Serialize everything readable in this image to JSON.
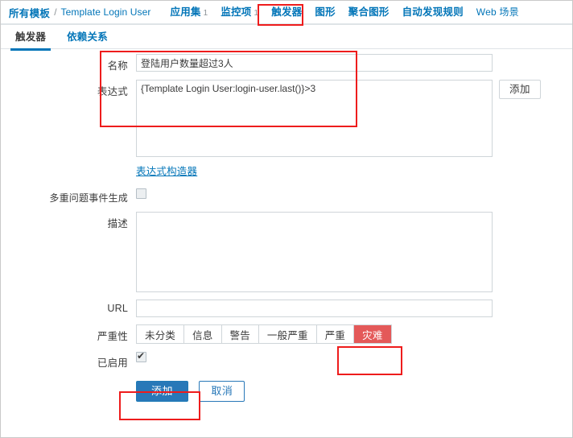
{
  "breadcrumb": {
    "root_label": "所有模板",
    "separator": "/",
    "template_name": "Template Login User"
  },
  "nav_tabs": [
    {
      "label": "应用集",
      "count": "1",
      "active": false,
      "latin": false
    },
    {
      "label": "监控项",
      "count": "1",
      "active": false,
      "latin": false
    },
    {
      "label": "触发器",
      "count": "",
      "active": true,
      "latin": false
    },
    {
      "label": "图形",
      "count": "",
      "active": false,
      "latin": false
    },
    {
      "label": "聚合图形",
      "count": "",
      "active": false,
      "latin": false
    },
    {
      "label": "自动发现规则",
      "count": "",
      "active": false,
      "latin": false
    },
    {
      "label": "Web 场景",
      "count": "",
      "active": false,
      "latin": true
    }
  ],
  "sub_tabs": [
    {
      "label": "触发器",
      "active": true
    },
    {
      "label": "依赖关系",
      "active": false
    }
  ],
  "form": {
    "name": {
      "label": "名称",
      "value": "登陆用户数量超过3人",
      "placeholder": ""
    },
    "expression": {
      "label": "表达式",
      "value": "{Template Login User:login-user.last()}>3",
      "placeholder": "",
      "add_button_label": "添加",
      "constructor_link_label": "表达式构造器"
    },
    "multiple_problem": {
      "label": "多重问题事件生成",
      "checked": false
    },
    "description": {
      "label": "描述",
      "value": "",
      "placeholder": ""
    },
    "url": {
      "label": "URL",
      "value": "",
      "placeholder": ""
    },
    "severity": {
      "label": "严重性",
      "options": [
        "未分类",
        "信息",
        "警告",
        "一般严重",
        "严重",
        "灾难"
      ],
      "selected": "灾难",
      "selected_color": "#e45959"
    },
    "enabled": {
      "label": "已启用",
      "checked": true
    },
    "actions": {
      "submit_label": "添加",
      "cancel_label": "取消"
    }
  },
  "annotations": {
    "accent_color": "#ee1c1c",
    "boxes": [
      {
        "name": "trigger-tab-highlight"
      },
      {
        "name": "name-expression-highlight"
      },
      {
        "name": "severity-disaster-highlight"
      },
      {
        "name": "add-button-highlight"
      }
    ]
  },
  "colors": {
    "link": "#0275b8",
    "primary_button": "#2878b8",
    "severity_selected": "#e45959",
    "annotation": "#ee1c1c"
  }
}
